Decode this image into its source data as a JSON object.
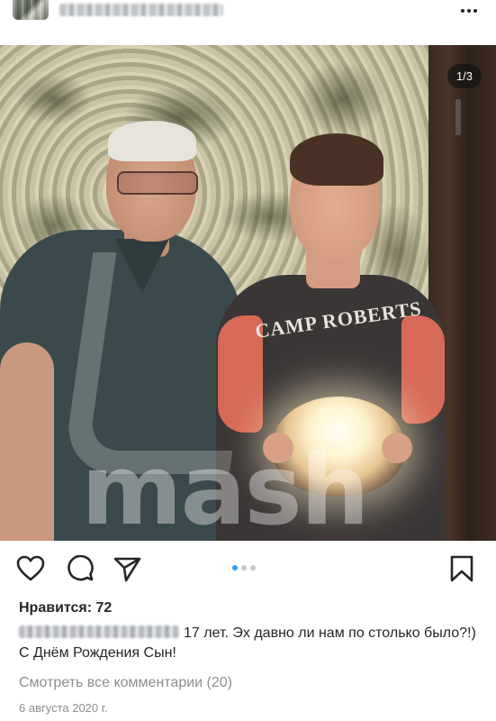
{
  "post": {
    "image_counter": "1/3",
    "shirt_print": "CAMP ROBERTS",
    "watermark_text": "mash",
    "carousel": {
      "count": 3,
      "active_index": 0
    },
    "likes_text": "Нравится: 72",
    "caption_text": "17 лет. Эх давно ли нам по столько было?!) С Днём Рождения Сын!",
    "view_comments_text": "Смотреть все комментарии (20)",
    "date_text": "6 августа 2020 г."
  },
  "icons": {
    "more": "more-horizontal-icon",
    "like": "heart-icon",
    "comment": "comment-icon",
    "share": "paper-plane-icon",
    "save": "bookmark-icon"
  },
  "colors": {
    "text": "#262626",
    "secondary_text": "#8e8e8e",
    "active_dot": "#3897f0",
    "inactive_dot": "#c7c7c7"
  }
}
